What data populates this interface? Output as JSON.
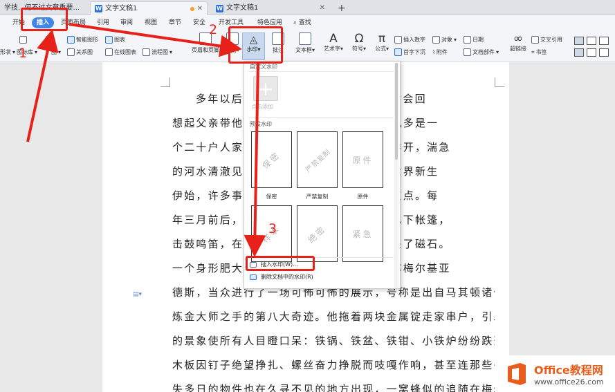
{
  "tabs": [
    {
      "label": "学技...何不过文章重要..."
    },
    {
      "label": "文字文稿1"
    },
    {
      "label": "文字文稿1"
    }
  ],
  "menu": [
    "开始",
    "插入",
    "页面布局",
    "引用",
    "审阅",
    "视图",
    "章节",
    "安全",
    "开发工具",
    "特色应用",
    "查找"
  ],
  "ribbon": {
    "shape": "形状",
    "icon_lib": "图标库",
    "chart_small": "图",
    "smartart": "智能图形",
    "chart": "图表",
    "relation": "关系图",
    "online_chart": "在线图表",
    "flowchart": "流程图",
    "header_footer": "页眉和页脚",
    "page_number": "页码",
    "watermark": "水印",
    "comment": "批注",
    "textbox": "文本框",
    "wordart": "艺术字",
    "symbol": "符号",
    "formula": "公式",
    "insert_number": "插入数字",
    "object": "对象",
    "date": "日期",
    "dropcap": "首字下沉",
    "attachment": "附件",
    "doc_parts": "文档部件",
    "hyperlink": "超链接",
    "crossref": "交叉引用",
    "bookmark": "书签"
  },
  "dropdown": {
    "custom_section": "自定义水印",
    "custom_add": "点击添加",
    "preset_section": "预设水印",
    "presets": [
      {
        "text": "保密",
        "label": "保密"
      },
      {
        "text": "严禁复制",
        "label": "严禁复制"
      },
      {
        "text": "原件",
        "label": "原件"
      },
      {
        "text": "样本",
        "label": ""
      },
      {
        "text": "绝密",
        "label": ""
      },
      {
        "text": "紧急",
        "label": ""
      }
    ],
    "insert_action": "插入水印(W)...",
    "delete_action": "删除文档中的水印(R)"
  },
  "document_lines": [
    "多年以后，……………… 恩迪亚上校将会回",
    "想起父亲带他…………………… 那时的马孔多是一",
    "个二十户人家……………………… 沿河岸排开，湍急",
    "的河水清澈见…………………… 前巨蛋。世界新生",
    "伊始，许多事…………………… 用手指指点点。每",
    "年三月前后，…………………… 来到村边扎下帐篷，",
    "击鼓鸣笛，在喧………………… 们他们带来了磁石。",
    "一个身形肥大……………………… 爪，自称梅尔基亚",
    "德斯，当众进行了一场可怖可怖的展示，号称是出自马其顿诸位",
    "炼金大师之手的第八大奇迹。他拖着两块金属锭走家串户，引发",
    "的景象使所有人目瞪口呆：铁锅、铁盆、铁钳、小铁炉纷纷跌落，",
    "木板因钉子绝望挣扎、螺丝奋力挣脱而吱嘎作响，甚至连那些丢",
    "失多日的物件也在久寻不见的地方出现，一窝蜂似的追随在梅尔"
  ],
  "annotations": {
    "n1": "1",
    "n2": "2",
    "n3": "3"
  },
  "logo": {
    "title": "Office教程网",
    "url": "www.office26.com"
  },
  "colors": {
    "accent": "#3f86e8",
    "annotation": "#e8201a",
    "logo": "#e95d1c"
  }
}
